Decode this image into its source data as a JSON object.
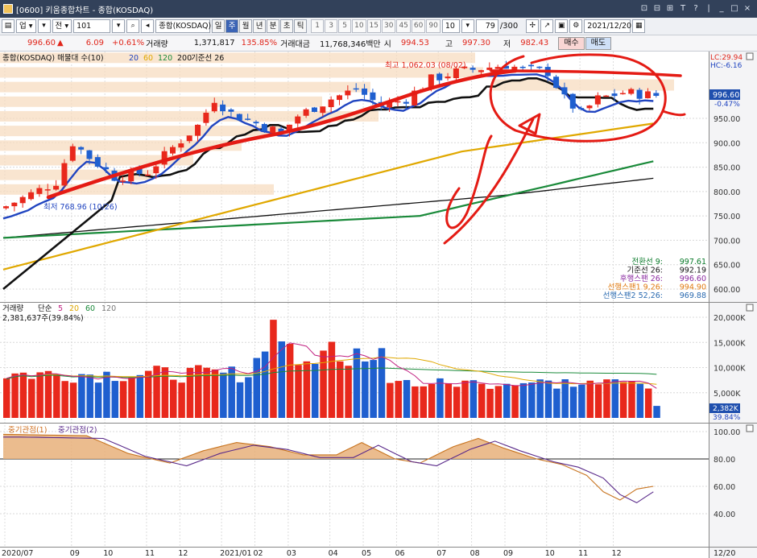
{
  "window": {
    "title": "[0600] 키움종합차트 - 종합(KOSDAQ)",
    "buttons": [
      "⊡",
      "⊟",
      "⊞",
      "T",
      "?",
      "|",
      "_",
      "□",
      "×"
    ]
  },
  "toolbar": {
    "market": "업",
    "compare": "전",
    "code": "101",
    "name": "종합(KOSDAQ)",
    "periods": [
      "일",
      "주",
      "월",
      "년",
      "분",
      "초",
      "틱"
    ],
    "selected_period": "주",
    "numbers": [
      "1",
      "3",
      "5",
      "10",
      "15",
      "30",
      "45",
      "60",
      "90"
    ],
    "interval": "10",
    "count": "79",
    "total": "/300",
    "date": "2021/12/20"
  },
  "quote": {
    "price": "996.60",
    "arrow": "▲",
    "change": "6.09",
    "change_pct": "+0.61%",
    "volume_label": "거래량",
    "volume": "1,371,817",
    "volume_ratio": "135.85%",
    "amount_label": "거래대금",
    "amount": "11,768,346백만",
    "open_label": "시",
    "open": "994.53",
    "high_label": "고",
    "high": "997.30",
    "low_label": "저",
    "low": "982.43",
    "buy": "매수",
    "sell": "매도"
  },
  "price_panel": {
    "legend_name": "종합(KOSDAQ) 매물대 수(10)",
    "legend_periods": [
      "20",
      "60",
      "120",
      "200"
    ],
    "legend_base": "기준선 26",
    "legend_colors": [
      "#2044c0",
      "#e0a800",
      "#1a8a3a",
      "#111111"
    ],
    "high_label": "최고 1,062.03 (08/02)",
    "low_label": "최저 768.96 (10/26)",
    "lc": "LC:29.94",
    "hc": "HC:-6.16",
    "current_price": "996.60",
    "current_pct": "-0.47%",
    "axis": [
      "950.00",
      "900.00",
      "850.00",
      "800.00",
      "750.00",
      "700.00",
      "650.00",
      "600.00"
    ],
    "ichimoku": [
      {
        "label": "전환선 9:",
        "value": "997.61",
        "color": "#0a7a2a"
      },
      {
        "label": "기준선 26:",
        "value": "992.19",
        "color": "#111111"
      },
      {
        "label": "후행스팬 26:",
        "value": "996.60",
        "color": "#8a2aa0"
      },
      {
        "label": "선행스팬1 9,26:",
        "value": "994.90",
        "color": "#e07a10"
      },
      {
        "label": "선행스팬2 52,26:",
        "value": "969.88",
        "color": "#2a6ab0"
      }
    ]
  },
  "volume_panel": {
    "legend_name": "거래량",
    "legend_type": "단순",
    "legend_periods": [
      "5",
      "20",
      "60",
      "120"
    ],
    "legend_colors": [
      "#c02080",
      "#e0a800",
      "#1a8a3a",
      "#777777"
    ],
    "current": "2,381,637주(39.84%)",
    "axis": [
      "20,000K",
      "15,000K",
      "10,000K",
      "5,000K"
    ],
    "marker": "2,382K",
    "marker_pct": "39.84%"
  },
  "osc_panel": {
    "legend_1": "중기관점(1)",
    "legend_2": "중기관점(2)",
    "axis": [
      "100.00",
      "80.00",
      "60.00",
      "40.00"
    ]
  },
  "x_axis": [
    "2020/07",
    "09",
    "10",
    "11",
    "12",
    "2021/01",
    "02",
    "03",
    "04",
    "05",
    "06",
    "07",
    "08",
    "09",
    "10",
    "11",
    "12",
    "12/20"
  ],
  "colors": {
    "up": "#e8281c",
    "down": "#1f5fcf",
    "annotation": "#e41b14"
  }
}
